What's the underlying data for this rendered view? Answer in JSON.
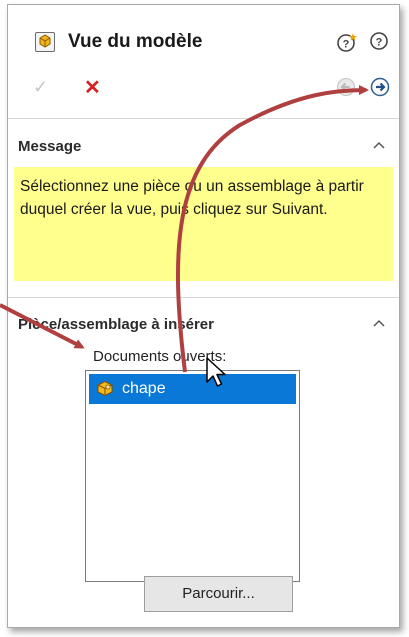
{
  "panel": {
    "title": "Vue du modèle",
    "title_icon": "model-view-icon",
    "help_icons": [
      "whats-new-help-icon",
      "help-icon"
    ],
    "actions": {
      "ok": "✓",
      "cancel": "✕"
    },
    "nav": [
      "back-arrow-icon",
      "next-arrow-icon"
    ]
  },
  "message_section": {
    "header": "Message",
    "text": "Sélectionnez une pièce ou un assemblage à partir duquel créer la vue, puis cliquez sur Suivant.",
    "background": "#ffff8e"
  },
  "insert_section": {
    "header": "Pièce/assemblage à insérer",
    "documents_label": "Documents ouverts:",
    "documents": [
      {
        "label": "chape",
        "icon": "part-icon",
        "selected": true
      }
    ],
    "browse_label": "Parcourir..."
  },
  "annotation_color": "#b04040",
  "selection_color": "#0a78d6"
}
